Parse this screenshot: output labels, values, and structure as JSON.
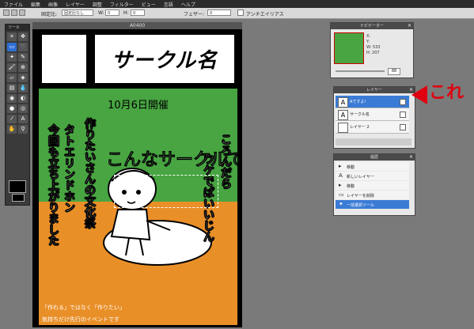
{
  "menubar": [
    "ファイル",
    "編集",
    "画像",
    "レイヤー",
    "調整",
    "フィルター",
    "ビュー",
    "言語",
    "ヘルプ"
  ],
  "optbar": {
    "label1": "固定比:",
    "select1": "固定比なし",
    "label_w": "W:",
    "label_h": "H:",
    "val_w": "0",
    "val_h": "0",
    "feather_label": "フェザー:",
    "feather_val": "0",
    "antialias": "アンチエイリアス"
  },
  "tools": {
    "title": "ツール",
    "icons": [
      "crop-icon",
      "move-icon",
      "marquee-icon",
      "lasso-icon",
      "wand-icon",
      "pencil-icon",
      "brush-icon",
      "clone-icon",
      "eraser-icon",
      "bucket-icon",
      "gradient-icon",
      "blur-icon",
      "sponge-icon",
      "dodge-icon",
      "burn-icon",
      "redeye-icon",
      "picker-icon",
      "text-icon",
      "hand-icon",
      "zoom-icon"
    ]
  },
  "document": {
    "title": "A0400",
    "circle_name": "サークル名",
    "date": "10月6日開催",
    "col1": "今回も立ち上がりました",
    "col2": "タトエリンドホン",
    "col3": "作りたいさんの文化祭",
    "col4": "ウケでばいいじん",
    "col5": "ころんだら",
    "overlay": "こんなサークルですよ！",
    "foot1": "「作れる」ではなく「作りたい」",
    "foot2": "気持ちだけ先行のイベントです"
  },
  "navigator": {
    "title": "ナビゲーター",
    "x_label": "X:",
    "y_label": "Y:",
    "w_label": "W:",
    "w_val": "533",
    "h_label": "H:",
    "h_val": "207",
    "zoom": "88"
  },
  "layers": {
    "title": "レイヤー",
    "items": [
      {
        "name": "Aですよ！",
        "thumb": "A",
        "selected": true
      },
      {
        "name": "サークル名",
        "thumb": "A",
        "selected": false
      },
      {
        "name": "レイヤー 2",
        "thumb": "",
        "selected": false
      }
    ]
  },
  "history": {
    "title": "履歴",
    "items": [
      {
        "name": "移動",
        "selected": false
      },
      {
        "name": "新しいレイヤー",
        "selected": false
      },
      {
        "name": "移動",
        "selected": false
      },
      {
        "name": "レイヤーを削除",
        "selected": false
      },
      {
        "name": "一括選択ツール",
        "selected": true
      }
    ]
  },
  "annotation": {
    "text": "これ",
    "color": "#e00010"
  },
  "colors": {
    "green": "#48a542",
    "orange": "#e98f28",
    "selection": "#3a7bd5"
  }
}
